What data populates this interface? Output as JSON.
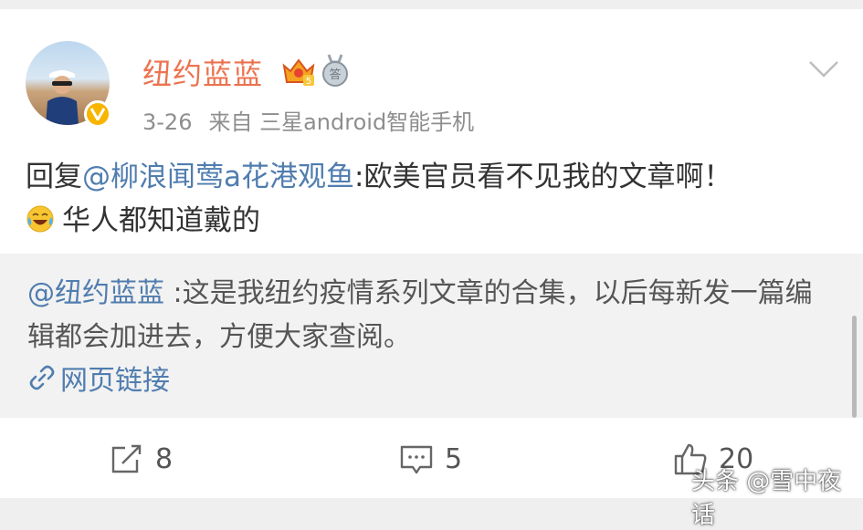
{
  "post": {
    "username": "纽约蓝蓝",
    "date": "3-26",
    "source": "来自 三星android智能手机",
    "reply_prefix": "回复",
    "reply_mention": "@柳浪闻莺a花港观鱼",
    "reply_text": ":欧美官员看不见我的文章啊！",
    "second_line": "华人都知道戴的"
  },
  "quote": {
    "mention": "@纽约蓝蓝",
    "text": " :这是我纽约疫情系列文章的合集，以后每新发一篇编辑都会加进去，方便大家查阅。",
    "link_label": "网页链接"
  },
  "actions": {
    "repost_count": "8",
    "comment_count": "5",
    "like_count": "20"
  },
  "watermark": "头条 @雪中夜话",
  "colors": {
    "username": "#eb7350",
    "link": "#507daf",
    "verified": "#f7b500"
  }
}
